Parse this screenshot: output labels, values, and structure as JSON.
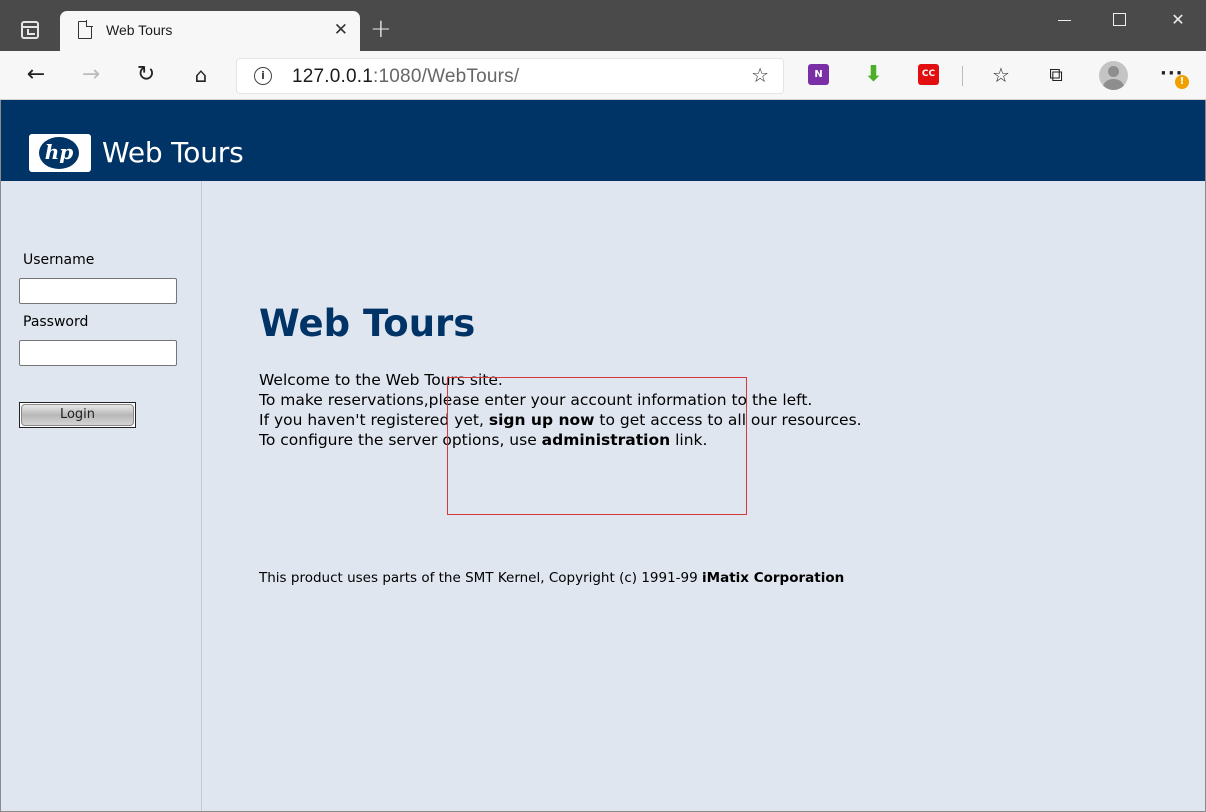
{
  "browser": {
    "tab_title": "Web Tours",
    "tab_close": "✕",
    "new_tab": "+",
    "url_host": "127.0.0.1",
    "url_rest": ":1080/WebTours/",
    "window_controls": {
      "minimize": "—",
      "maximize": "☐",
      "close": "✕"
    },
    "toolbar_icons": [
      "back-icon",
      "forward-icon",
      "refresh-icon",
      "home-icon",
      "info-icon",
      "add-favorite-icon",
      "onenote-icon",
      "download-icon",
      "cc-icon",
      "favorites-icon",
      "collections-icon",
      "profile-icon",
      "more-icon"
    ],
    "ext_onenote": "N",
    "ext_cc": "CC",
    "more_label": "···",
    "warning_badge": "!"
  },
  "header": {
    "logo_text": "hp",
    "brand": "Web Tours",
    "bg_color": "#003366"
  },
  "login": {
    "username_label": "Username",
    "username_value": "",
    "password_label": "Password",
    "password_value": "",
    "button_label": "Login"
  },
  "main": {
    "title": "Web Tours",
    "line1": "Welcome to the Web Tours site.",
    "line2": "To make reservations,please enter your account information to the left.",
    "line3_pre": "If you haven't registered yet, ",
    "line3_link": "sign up now",
    "line3_post": " to get access to all our resources.",
    "line4_pre": "To configure the server options, use ",
    "line4_link": "administration",
    "line4_post": " link.",
    "footer_pre": "This product uses parts of the SMT Kernel, Copyright (c) 1991-99 ",
    "footer_bold": "iMatix Corporation"
  }
}
